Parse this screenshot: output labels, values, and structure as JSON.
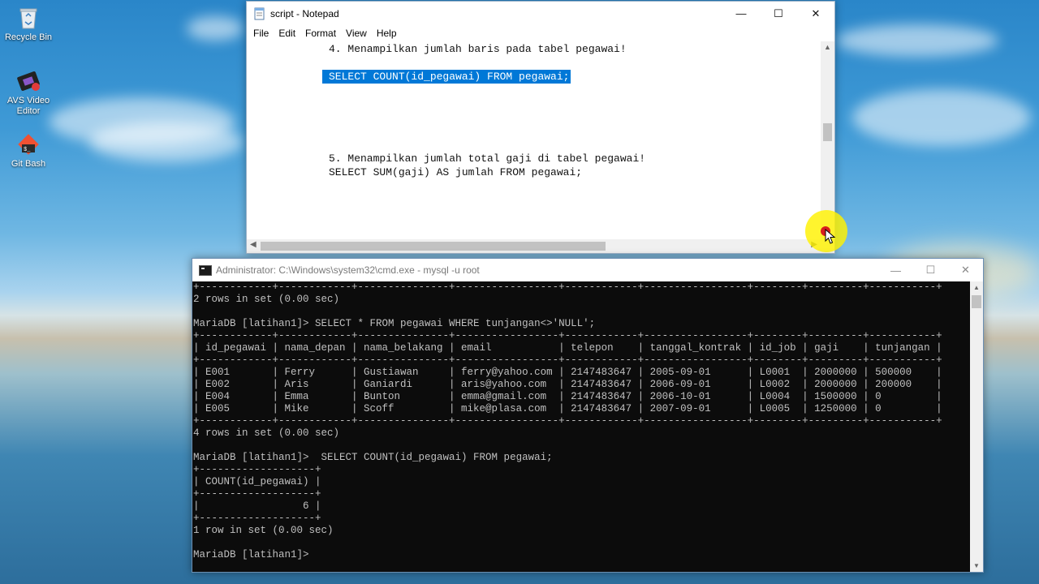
{
  "desktop": {
    "icons": [
      {
        "label": "Recycle Bin",
        "icon": "recycle-bin-icon"
      },
      {
        "label": "AVS Video Editor",
        "icon": "film-strip-icon"
      },
      {
        "label": "Git Bash",
        "icon": "git-icon"
      }
    ]
  },
  "notepad": {
    "title": "script - Notepad",
    "window_controls": {
      "minimize": "—",
      "maximize": "☐",
      "close": "✕"
    },
    "menu": [
      "File",
      "Edit",
      "Format",
      "View",
      "Help"
    ],
    "lines": [
      "4. Menampilkan jumlah baris pada tabel pegawai!",
      "SELECT COUNT(id_pegawai) FROM pegawai;",
      "5. Menampilkan jumlah total gaji di tabel pegawai!",
      "SELECT SUM(gaji) AS jumlah FROM pegawai;"
    ],
    "selected_line_index": 1,
    "selection_color": "#0078d7"
  },
  "cmd": {
    "title": "Administrator: C:\\Windows\\system32\\cmd.exe - mysql  -u root",
    "window_controls": {
      "minimize": "—",
      "maximize": "☐",
      "close": "✕"
    },
    "lines": [
      "+------------+------------+---------------+-----------------+------------+-----------------+--------+---------+-----------+",
      "2 rows in set (0.00 sec)",
      "",
      "MariaDB [latihan1]> SELECT * FROM pegawai WHERE tunjangan<>'NULL';",
      "+------------+------------+---------------+-----------------+------------+-----------------+--------+---------+-----------+",
      "| id_pegawai | nama_depan | nama_belakang | email           | telepon    | tanggal_kontrak | id_job | gaji    | tunjangan |",
      "+------------+------------+---------------+-----------------+------------+-----------------+--------+---------+-----------+",
      "| E001       | Ferry      | Gustiawan     | ferry@yahoo.com | 2147483647 | 2005-09-01      | L0001  | 2000000 | 500000    |",
      "| E002       | Aris       | Ganiardi      | aris@yahoo.com  | 2147483647 | 2006-09-01      | L0002  | 2000000 | 200000    |",
      "| E004       | Emma       | Bunton        | emma@gmail.com  | 2147483647 | 2006-10-01      | L0004  | 1500000 | 0         |",
      "| E005       | Mike       | Scoff         | mike@plasa.com  | 2147483647 | 2007-09-01      | L0005  | 1250000 | 0         |",
      "+------------+------------+---------------+-----------------+------------+-----------------+--------+---------+-----------+",
      "4 rows in set (0.00 sec)",
      "",
      "MariaDB [latihan1]>  SELECT COUNT(id_pegawai) FROM pegawai;",
      "+-------------------+",
      "| COUNT(id_pegawai) |",
      "+-------------------+",
      "|                 6 |",
      "+-------------------+",
      "1 row in set (0.00 sec)",
      "",
      "MariaDB [latihan1]>"
    ]
  }
}
